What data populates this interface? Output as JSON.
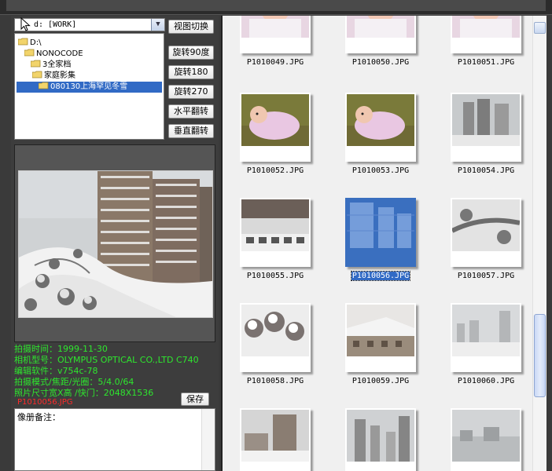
{
  "toolbar": {
    "drive": "d: [WORK]",
    "buttons": [
      "视图切换",
      "旋转90度",
      "旋转180",
      "旋转270",
      "水平翻转",
      "垂直翻转"
    ]
  },
  "tree": [
    {
      "label": "D:\\"
    },
    {
      "label": "NONOCODE"
    },
    {
      "label": "3全家档"
    },
    {
      "label": "家庭影集"
    },
    {
      "label": "080130上海罕见冬雪",
      "selected": true
    }
  ],
  "info": {
    "lines": [
      "拍摄时间：1999-11-30",
      "相机型号：OLYMPUS OPTICAL CO.,LTD  C740",
      "编辑软件：v754c-78",
      "拍摄模式/焦距/光圈：5/4.0/64",
      "照片尺寸宽X高 /快门：2048X1536"
    ],
    "current_file": "P1010056.JPG",
    "save_label": "保存",
    "notes_label": "像册备注："
  },
  "thumbnails": [
    {
      "name": "P1010049.JPG",
      "kind": "baby"
    },
    {
      "name": "P1010050.JPG",
      "kind": "baby"
    },
    {
      "name": "P1010051.JPG",
      "kind": "baby"
    },
    {
      "name": "P1010052.JPG",
      "kind": "baby2"
    },
    {
      "name": "P1010053.JPG",
      "kind": "baby2"
    },
    {
      "name": "P1010054.JPG",
      "kind": "buildings"
    },
    {
      "name": "P1010055.JPG",
      "kind": "snowcars"
    },
    {
      "name": "P1010056.JPG",
      "kind": "selected",
      "selected": true
    },
    {
      "name": "P1010057.JPG",
      "kind": "snowroad"
    },
    {
      "name": "P1010058.JPG",
      "kind": "snowtrees"
    },
    {
      "name": "P1010059.JPG",
      "kind": "snowroof"
    },
    {
      "name": "P1010060.JPG",
      "kind": "foggy"
    },
    {
      "name": "",
      "kind": "snowtown"
    },
    {
      "name": "",
      "kind": "towers"
    },
    {
      "name": "",
      "kind": "foggy2"
    }
  ],
  "colors": {
    "info_text": "#2ee62e",
    "filename_red": "#ff2a2a",
    "selection": "#316ac5"
  }
}
